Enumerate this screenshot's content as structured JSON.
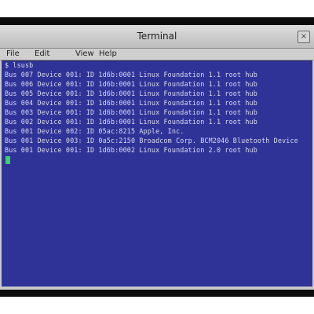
{
  "window": {
    "title": "Terminal",
    "close_glyph": "×"
  },
  "menu": {
    "items": [
      "File",
      "Edit",
      "View",
      "Help"
    ]
  },
  "terminal": {
    "prompt_line": "$ lsusb",
    "lines": [
      "Bus 007 Device 001: ID 1d6b:0001 Linux Foundation 1.1 root hub",
      "Bus 006 Device 001: ID 1d6b:0001 Linux Foundation 1.1 root hub",
      "Bus 005 Device 001: ID 1d6b:0001 Linux Foundation 1.1 root hub",
      "Bus 004 Device 001: ID 1d6b:0001 Linux Foundation 1.1 root hub",
      "Bus 003 Device 001: ID 1d6b:0001 Linux Foundation 1.1 root hub",
      "Bus 002 Device 001: ID 1d6b:0001 Linux Foundation 1.1 root hub",
      "Bus 001 Device 002: ID 05ac:8215 Apple, Inc.",
      "Bus 001 Device 003: ID 0a5c:2150 Broadcom Corp. BCM2046 Bluetooth Device",
      "Bus 001 Device 001: ID 1d6b:0002 Linux Foundation 2.0 root hub"
    ],
    "cursor_color": "#36d36a",
    "background_color": "#2f3398"
  }
}
